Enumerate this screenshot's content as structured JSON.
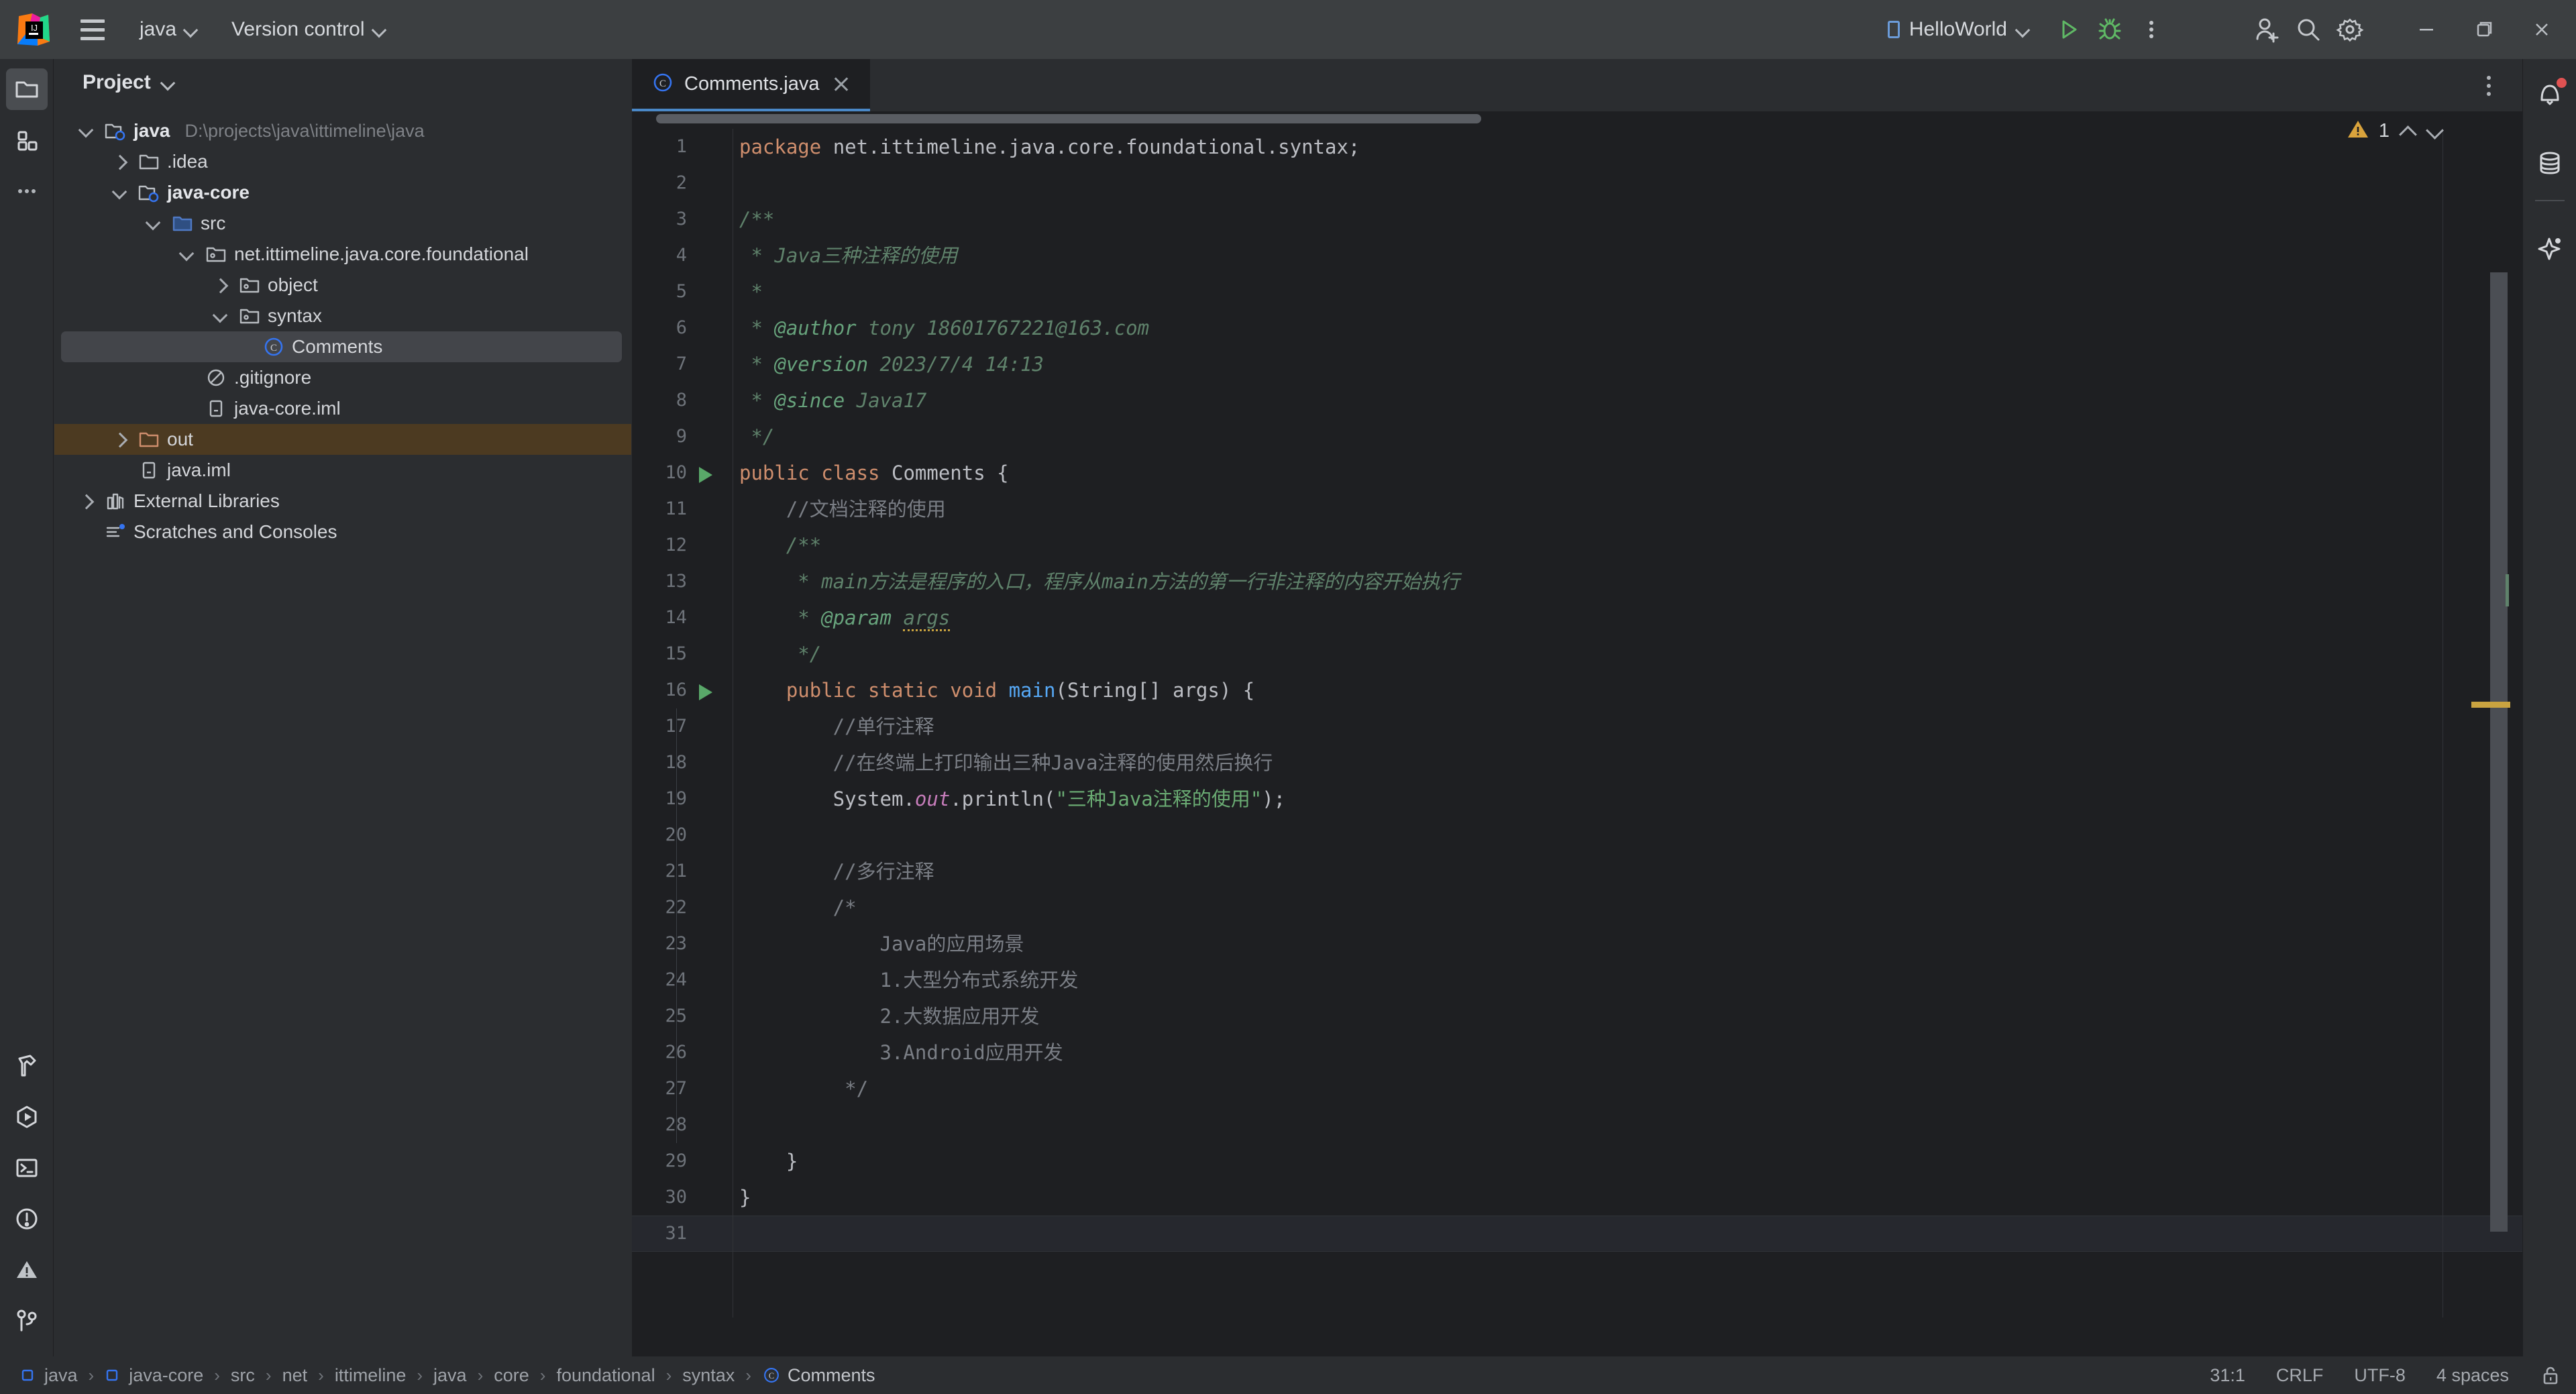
{
  "titlebar": {
    "logo_icon": "intellij-idea-logo",
    "menu_icon": "hamburger-menu-icon",
    "project_menu": "java",
    "vcs_menu": "Version control",
    "run_config": "HelloWorld",
    "run_icon": "run-icon",
    "debug_icon": "debug-icon",
    "more_icon": "more-vertical-icon",
    "add_user_icon": "add-user-icon",
    "search_icon": "search-icon",
    "settings_icon": "gear-icon",
    "minimize_icon": "minimize-icon",
    "maximize_icon": "maximize-icon",
    "close_icon": "close-icon"
  },
  "left_strip": {
    "top_icons": [
      "project-folder-icon",
      "commit-structure-icon",
      "more-tool-windows-icon"
    ],
    "bottom_icons": [
      "build-hammer-icon",
      "run-hexagon-icon",
      "terminal-icon",
      "problems-icon",
      "warning-icon",
      "git-branch-icon"
    ]
  },
  "right_strip": {
    "icons": [
      "notifications-bell-icon",
      "database-icon",
      "ai-assistant-icon"
    ],
    "notification_badge_color": "#e05252"
  },
  "project_panel": {
    "title": "Project",
    "tree": [
      {
        "label": "java",
        "path": "D:\\projects\\java\\ittimeline\\java",
        "icon": "module-folder-icon",
        "arrow": "down",
        "indent": 0,
        "bold": true
      },
      {
        "label": ".idea",
        "path": "",
        "icon": "folder-icon",
        "arrow": "right",
        "indent": 1,
        "bold": false
      },
      {
        "label": "java-core",
        "path": "",
        "icon": "module-folder-icon",
        "arrow": "down",
        "indent": 1,
        "bold": true
      },
      {
        "label": "src",
        "path": "",
        "icon": "source-folder-icon",
        "arrow": "down",
        "indent": 2,
        "bold": false
      },
      {
        "label": "net.ittimeline.java.core.foundational",
        "path": "",
        "icon": "package-icon",
        "arrow": "down",
        "indent": 3,
        "bold": false
      },
      {
        "label": "object",
        "path": "",
        "icon": "package-icon",
        "arrow": "right",
        "indent": 4,
        "bold": false
      },
      {
        "label": "syntax",
        "path": "",
        "icon": "package-icon",
        "arrow": "down",
        "indent": 4,
        "bold": false
      },
      {
        "label": "Comments",
        "path": "",
        "icon": "java-class-icon",
        "arrow": "none",
        "indent": 5,
        "bold": false,
        "state": "selected"
      },
      {
        "label": ".gitignore",
        "path": "",
        "icon": "gitignore-icon",
        "arrow": "none",
        "indent": 3,
        "bold": false
      },
      {
        "label": "java-core.iml",
        "path": "",
        "icon": "iml-file-icon",
        "arrow": "none",
        "indent": 3,
        "bold": false
      },
      {
        "label": "out",
        "path": "",
        "icon": "excluded-folder-icon",
        "arrow": "right",
        "indent": 1,
        "bold": false,
        "state": "highlighted"
      },
      {
        "label": "java.iml",
        "path": "",
        "icon": "iml-file-icon",
        "arrow": "none",
        "indent": 1,
        "bold": false
      },
      {
        "label": "External Libraries",
        "path": "",
        "icon": "libraries-icon",
        "arrow": "right",
        "indent": 0,
        "bold": false
      },
      {
        "label": "Scratches and Consoles",
        "path": "",
        "icon": "scratches-icon",
        "arrow": "none",
        "indent": 0,
        "bold": false
      }
    ]
  },
  "editor": {
    "tab": {
      "label": "Comments.java",
      "icon": "java-class-icon",
      "close_icon": "close-icon"
    },
    "tab_options_icon": "more-vertical-icon",
    "inspection": {
      "icon": "warning-triangle-icon",
      "count": "1",
      "prev_icon": "chevron-up-icon",
      "next_icon": "chevron-down-icon"
    },
    "caret_line": 31,
    "run_gutter_lines": [
      10,
      16
    ],
    "lines": [
      {
        "n": 1,
        "tokens": [
          {
            "t": "package ",
            "c": "kw"
          },
          {
            "t": "net.ittimeline.java.core.foundational.syntax;",
            "c": "plain"
          }
        ]
      },
      {
        "n": 2,
        "tokens": []
      },
      {
        "n": 3,
        "tokens": [
          {
            "t": "/**",
            "c": "doc"
          }
        ]
      },
      {
        "n": 4,
        "tokens": [
          {
            "t": " * Java三种注释的使用",
            "c": "doc"
          }
        ]
      },
      {
        "n": 5,
        "tokens": [
          {
            "t": " *",
            "c": "doc"
          }
        ]
      },
      {
        "n": 6,
        "tokens": [
          {
            "t": " * ",
            "c": "doc"
          },
          {
            "t": "@author",
            "c": "doctag"
          },
          {
            "t": " tony 18601767221@163.com",
            "c": "doc"
          }
        ]
      },
      {
        "n": 7,
        "tokens": [
          {
            "t": " * ",
            "c": "doc"
          },
          {
            "t": "@version",
            "c": "doctag"
          },
          {
            "t": " 2023/7/4 14:13",
            "c": "doc"
          }
        ]
      },
      {
        "n": 8,
        "tokens": [
          {
            "t": " * ",
            "c": "doc"
          },
          {
            "t": "@since",
            "c": "doctag"
          },
          {
            "t": " Java17",
            "c": "doc"
          }
        ]
      },
      {
        "n": 9,
        "tokens": [
          {
            "t": " */",
            "c": "doc"
          }
        ]
      },
      {
        "n": 10,
        "tokens": [
          {
            "t": "public class ",
            "c": "kw"
          },
          {
            "t": "Comments ",
            "c": "cls"
          },
          {
            "t": "{",
            "c": "plain"
          }
        ]
      },
      {
        "n": 11,
        "tokens": [
          {
            "t": "    //文档注释的使用",
            "c": "cmt"
          }
        ]
      },
      {
        "n": 12,
        "tokens": [
          {
            "t": "    /**",
            "c": "doc"
          }
        ]
      },
      {
        "n": 13,
        "tokens": [
          {
            "t": "     * main方法是程序的入口，程序从main方法的第一行非注释的内容开始执行",
            "c": "doc"
          }
        ]
      },
      {
        "n": 14,
        "tokens": [
          {
            "t": "     * ",
            "c": "doc"
          },
          {
            "t": "@param",
            "c": "doctag"
          },
          {
            "t": " ",
            "c": "doc"
          },
          {
            "t": "args",
            "c": "doc warnw"
          }
        ]
      },
      {
        "n": 15,
        "tokens": [
          {
            "t": "     */",
            "c": "doc"
          }
        ]
      },
      {
        "n": 16,
        "tokens": [
          {
            "t": "    ",
            "c": "plain"
          },
          {
            "t": "public static void ",
            "c": "kw"
          },
          {
            "t": "main",
            "c": "mth"
          },
          {
            "t": "(String[] args) {",
            "c": "plain"
          }
        ]
      },
      {
        "n": 17,
        "tokens": [
          {
            "t": "        //单行注释",
            "c": "cmt"
          }
        ]
      },
      {
        "n": 18,
        "tokens": [
          {
            "t": "        //在终端上打印输出三种Java注释的使用然后换行",
            "c": "cmt"
          }
        ]
      },
      {
        "n": 19,
        "tokens": [
          {
            "t": "        System.",
            "c": "plain"
          },
          {
            "t": "out",
            "c": "fld"
          },
          {
            "t": ".println(",
            "c": "plain"
          },
          {
            "t": "\"三种Java注释的使用\"",
            "c": "str"
          },
          {
            "t": ");",
            "c": "plain"
          }
        ]
      },
      {
        "n": 20,
        "tokens": []
      },
      {
        "n": 21,
        "tokens": [
          {
            "t": "        //多行注释",
            "c": "cmt"
          }
        ]
      },
      {
        "n": 22,
        "tokens": [
          {
            "t": "        /*",
            "c": "cmt"
          }
        ]
      },
      {
        "n": 23,
        "tokens": [
          {
            "t": "            Java的应用场景",
            "c": "cmt"
          }
        ]
      },
      {
        "n": 24,
        "tokens": [
          {
            "t": "            1.大型分布式系统开发",
            "c": "cmt"
          }
        ]
      },
      {
        "n": 25,
        "tokens": [
          {
            "t": "            2.大数据应用开发",
            "c": "cmt"
          }
        ]
      },
      {
        "n": 26,
        "tokens": [
          {
            "t": "            3.Android应用开发",
            "c": "cmt"
          }
        ]
      },
      {
        "n": 27,
        "tokens": [
          {
            "t": "         */",
            "c": "cmt"
          }
        ]
      },
      {
        "n": 28,
        "tokens": []
      },
      {
        "n": 29,
        "tokens": [
          {
            "t": "    }",
            "c": "plain"
          }
        ]
      },
      {
        "n": 30,
        "tokens": [
          {
            "t": "}",
            "c": "plain"
          }
        ]
      },
      {
        "n": 31,
        "tokens": []
      }
    ]
  },
  "statusbar": {
    "breadcrumb": [
      {
        "label": "java",
        "icon": "module-icon"
      },
      {
        "label": "java-core",
        "icon": "module-icon"
      },
      {
        "label": "src",
        "icon": ""
      },
      {
        "label": "net",
        "icon": ""
      },
      {
        "label": "ittimeline",
        "icon": ""
      },
      {
        "label": "java",
        "icon": ""
      },
      {
        "label": "core",
        "icon": ""
      },
      {
        "label": "foundational",
        "icon": ""
      },
      {
        "label": "syntax",
        "icon": ""
      },
      {
        "label": "Comments",
        "icon": "java-class-icon"
      }
    ],
    "separator": "›",
    "caret_position": "31:1",
    "line_separator": "CRLF",
    "encoding": "UTF-8",
    "indent": "4 spaces",
    "lock_icon": "unlocked-icon"
  },
  "colors": {
    "titlebar_bg": "#3c3f41",
    "panel_bg": "#2b2d30",
    "editor_bg": "#1e1f22",
    "tab_accent": "#4a88c7",
    "selection": "#43454a",
    "excluded": "#4c3a21",
    "warning": "#c9a340",
    "run_green": "#59a869"
  }
}
